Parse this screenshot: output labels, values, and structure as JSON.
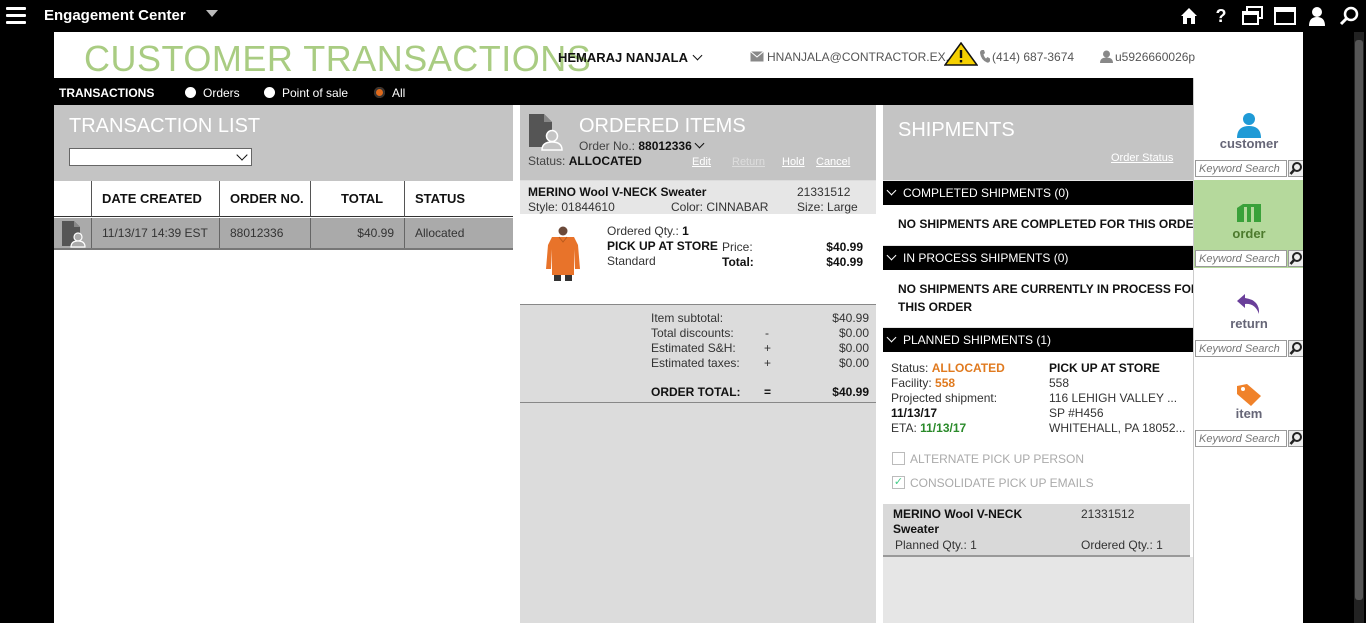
{
  "topbar": {
    "app_title": "Engagement Center",
    "icons": [
      "home-icon",
      "help-icon",
      "windows-icon",
      "window-icon",
      "user-icon",
      "search-icon"
    ]
  },
  "customer": {
    "page_title": "CUSTOMER TRANSACTIONS",
    "name": "HEMARAJ NANJALA",
    "email": "HNANJALA@CONTRACTOR.EX...",
    "phone": "(414) 687-3674",
    "user_id": "u5926660026p"
  },
  "transactions_bar": {
    "label": "TRANSACTIONS",
    "options": [
      {
        "label": "Orders",
        "selected": false
      },
      {
        "label": "Point of sale",
        "selected": false
      },
      {
        "label": "All",
        "selected": true
      }
    ]
  },
  "transaction_list": {
    "title": "TRANSACTION LIST",
    "filter_value": "",
    "columns": [
      "DATE CREATED",
      "ORDER NO.",
      "TOTAL",
      "STATUS"
    ],
    "rows": [
      {
        "date": "11/13/17 14:39 EST",
        "order_no": "88012336",
        "total": "$40.99",
        "status": "Allocated"
      }
    ]
  },
  "ordered_items": {
    "title": "ORDERED ITEMS",
    "order_no_label": "Order No.:",
    "order_no": "88012336",
    "status_label": "Status:",
    "status": "ALLOCATED",
    "actions": {
      "edit": "Edit",
      "return": "Return",
      "hold": "Hold",
      "cancel": "Cancel"
    },
    "item": {
      "name": "MERINO Wool V-NECK Sweater",
      "sku": "21331512",
      "style_label": "Style:",
      "style": "01844610",
      "color_label": "Color:",
      "color": "CINNABAR",
      "size_label": "Size:",
      "size": "Large",
      "qty_label": "Ordered Qty.:",
      "qty": "1",
      "fulfillment": "PICK UP AT STORE",
      "shipping": "Standard",
      "price_label": "Price:",
      "price": "$40.99",
      "total_label": "Total:",
      "total": "$40.99"
    },
    "totals": {
      "subtotal_label": "Item subtotal:",
      "subtotal": "$40.99",
      "discounts_label": "Total discounts:",
      "discounts_sign": "-",
      "discounts": "$0.00",
      "sh_label": "Estimated S&H:",
      "sh_sign": "+",
      "sh": "$0.00",
      "taxes_label": "Estimated taxes:",
      "taxes_sign": "+",
      "taxes": "$0.00",
      "order_total_label": "ORDER TOTAL:",
      "order_total_sign": "=",
      "order_total": "$40.99"
    }
  },
  "shipments": {
    "title": "SHIPMENTS",
    "order_status_link": "Order Status",
    "completed": {
      "header": "COMPLETED SHIPMENTS (0)",
      "message": "NO SHIPMENTS ARE COMPLETED FOR THIS ORDER"
    },
    "in_process": {
      "header": "IN PROCESS SHIPMENTS (0)",
      "message_line1": "NO SHIPMENTS ARE CURRENTLY IN PROCESS FOR",
      "message_line2": "THIS ORDER"
    },
    "planned": {
      "header": "PLANNED SHIPMENTS (1)",
      "status_label": "Status:",
      "status": "ALLOCATED",
      "facility_label": "Facility:",
      "facility": "558",
      "projected_label": "Projected shipment:",
      "projected": "11/13/17",
      "eta_label": "ETA:",
      "eta": "11/13/17",
      "pickup_title": "PICK UP AT STORE",
      "store_no": "558",
      "address1": "116 LEHIGH VALLEY ...",
      "address2": "SP #H456",
      "address3": "WHITEHALL, PA 18052...",
      "alt_pickup_label": "ALTERNATE PICK UP PERSON",
      "alt_pickup_checked": false,
      "consolidate_label": "CONSOLIDATE PICK UP EMAILS",
      "consolidate_checked": true,
      "item_name_line1": "MERINO Wool V-NECK",
      "item_name_line2": "Sweater",
      "item_sku": "21331512",
      "planned_qty_label": "Planned Qty.:",
      "planned_qty": "1",
      "ordered_qty_label": "Ordered Qty.:",
      "ordered_qty": "1"
    }
  },
  "sidebar": {
    "items": [
      {
        "label": "customer",
        "search_placeholder": "Keyword Search",
        "active": false
      },
      {
        "label": "order",
        "search_placeholder": "Keyword Search",
        "active": true
      },
      {
        "label": "return",
        "search_placeholder": "Keyword Search",
        "active": false
      },
      {
        "label": "item",
        "search_placeholder": "Keyword Search",
        "active": false
      }
    ]
  },
  "colors": {
    "title_green": "#a9cc82",
    "accent_orange": "#e07a1f",
    "eta_green": "#2a8a2a",
    "panel_gray": "#c4c4c4",
    "sidebar_active": "#b5d99c"
  }
}
